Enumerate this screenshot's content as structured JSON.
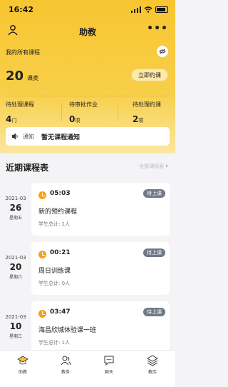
{
  "status": {
    "time": "16:42"
  },
  "nav": {
    "title": "助教"
  },
  "summary": {
    "all_courses_label": "我的所有课程",
    "count": "20",
    "count_unit": "课类",
    "book_button": "立即约课"
  },
  "stats": [
    {
      "label": "待处理课程",
      "value": "4",
      "unit": "门"
    },
    {
      "label": "待审批作业",
      "value": "0",
      "unit": "项"
    },
    {
      "label": "待处理约课",
      "value": "2",
      "unit": "项"
    }
  ],
  "notice": {
    "tag": "通知",
    "text": "暂无课程通知"
  },
  "schedule": {
    "title": "近期课程表",
    "link": "全部课程表",
    "rows": [
      {
        "ym": "2021-03",
        "day": "26",
        "weekday": "星期五",
        "time": "05:03",
        "badge": "待上课",
        "title": "新的预约课程",
        "students": "学生总计: 1人"
      },
      {
        "ym": "2021-03",
        "day": "20",
        "weekday": "星期六",
        "time": "00:21",
        "badge": "待上课",
        "title": "周日训练课",
        "students": "学生总计: 0人"
      },
      {
        "ym": "2021-03",
        "day": "10",
        "weekday": "星期三",
        "time": "03:47",
        "badge": "待上课",
        "title": "海昌欣城体验课一班",
        "students": "学生总计: 1人"
      }
    ]
  },
  "tabs": [
    {
      "label": "助教",
      "icon": "mortarboard-icon"
    },
    {
      "label": "教务",
      "icon": "people-icon"
    },
    {
      "label": "聊天",
      "icon": "chat-icon"
    },
    {
      "label": "教库",
      "icon": "layers-icon"
    }
  ],
  "colors": {
    "accent": "#f7c531",
    "clock": "#f7a21b",
    "badge": "#6f7a86"
  }
}
